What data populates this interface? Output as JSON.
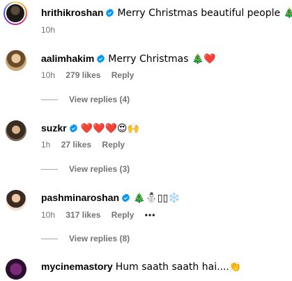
{
  "comments": [
    {
      "username": "hrithikroshan",
      "text": "Merry Christmas beautiful people 🎄",
      "time": "10h",
      "likes": "",
      "reply_label": "",
      "view_replies": ""
    },
    {
      "username": "aalimhakim",
      "text": "Merry Christmas 🎄❤️",
      "time": "10h",
      "likes": "279 likes",
      "reply_label": "Reply",
      "view_replies": "View replies (4)"
    },
    {
      "username": "suzkr",
      "text": "❤️❤️❤️😍🙌",
      "time": "1h",
      "likes": "27 likes",
      "reply_label": "Reply",
      "view_replies": "View replies (3)"
    },
    {
      "username": "pashminaroshan",
      "text": "🎄⛄▯▯❄️",
      "time": "10h",
      "likes": "317 likes",
      "reply_label": "Reply",
      "more": "•••",
      "view_replies": "View replies (8)"
    },
    {
      "username": "mycinemastory",
      "text": "Hum saath saath hai....👏",
      "time": "",
      "likes": "",
      "reply_label": "",
      "view_replies": ""
    }
  ],
  "colors": {
    "verified": "#0095f6",
    "meta_text": "#737373",
    "heart": "#e0245e"
  },
  "icons": {
    "verified": "verified-badge-icon",
    "more": "more-options-icon"
  }
}
